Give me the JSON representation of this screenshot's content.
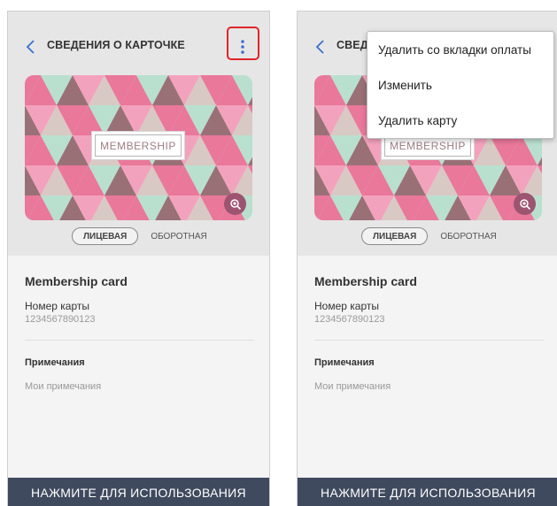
{
  "screens": [
    {
      "header": {
        "title": "СВЕДЕНИЯ О КАРТОЧКЕ"
      },
      "card": {
        "label": "MEMBERSHIP"
      },
      "sides": {
        "front": "ЛИЦЕВАЯ",
        "back": "ОБОРОТНАЯ"
      },
      "details": {
        "card_name": "Membership card",
        "number_label": "Номер карты",
        "number_value": "1234567890123",
        "notes_label": "Примечания",
        "notes_value": "Мои примечания"
      },
      "bottom_button": "НАЖМИТЕ ДЛЯ ИСПОЛЬЗОВАНИЯ"
    },
    {
      "header": {
        "title": "СВЕДЕНИЯ О КАРТОЧКЕ"
      },
      "card": {
        "label": "MEMBERSHIP"
      },
      "sides": {
        "front": "ЛИЦЕВАЯ",
        "back": "ОБОРОТНАЯ"
      },
      "details": {
        "card_name": "Membership card",
        "number_label": "Номер карты",
        "number_value": "1234567890123",
        "notes_label": "Примечания",
        "notes_value": "Мои примечания"
      },
      "bottom_button": "НАЖМИТЕ ДЛЯ ИСПОЛЬЗОВАНИЯ",
      "menu": {
        "items": [
          "Удалить со вкладки оплаты",
          "Изменить",
          "Удалить карту"
        ]
      }
    }
  ],
  "icons": {
    "back": "chevron-left-icon",
    "more": "more-vertical-icon",
    "zoom": "zoom-in-icon"
  },
  "colors": {
    "accent": "#3b6fcf",
    "highlight": "#e0242b",
    "bottom_bar": "#3f4a5e",
    "card_pink": "#e9789b",
    "card_mint": "#b9e0cf",
    "card_mauve": "#9a7077"
  }
}
